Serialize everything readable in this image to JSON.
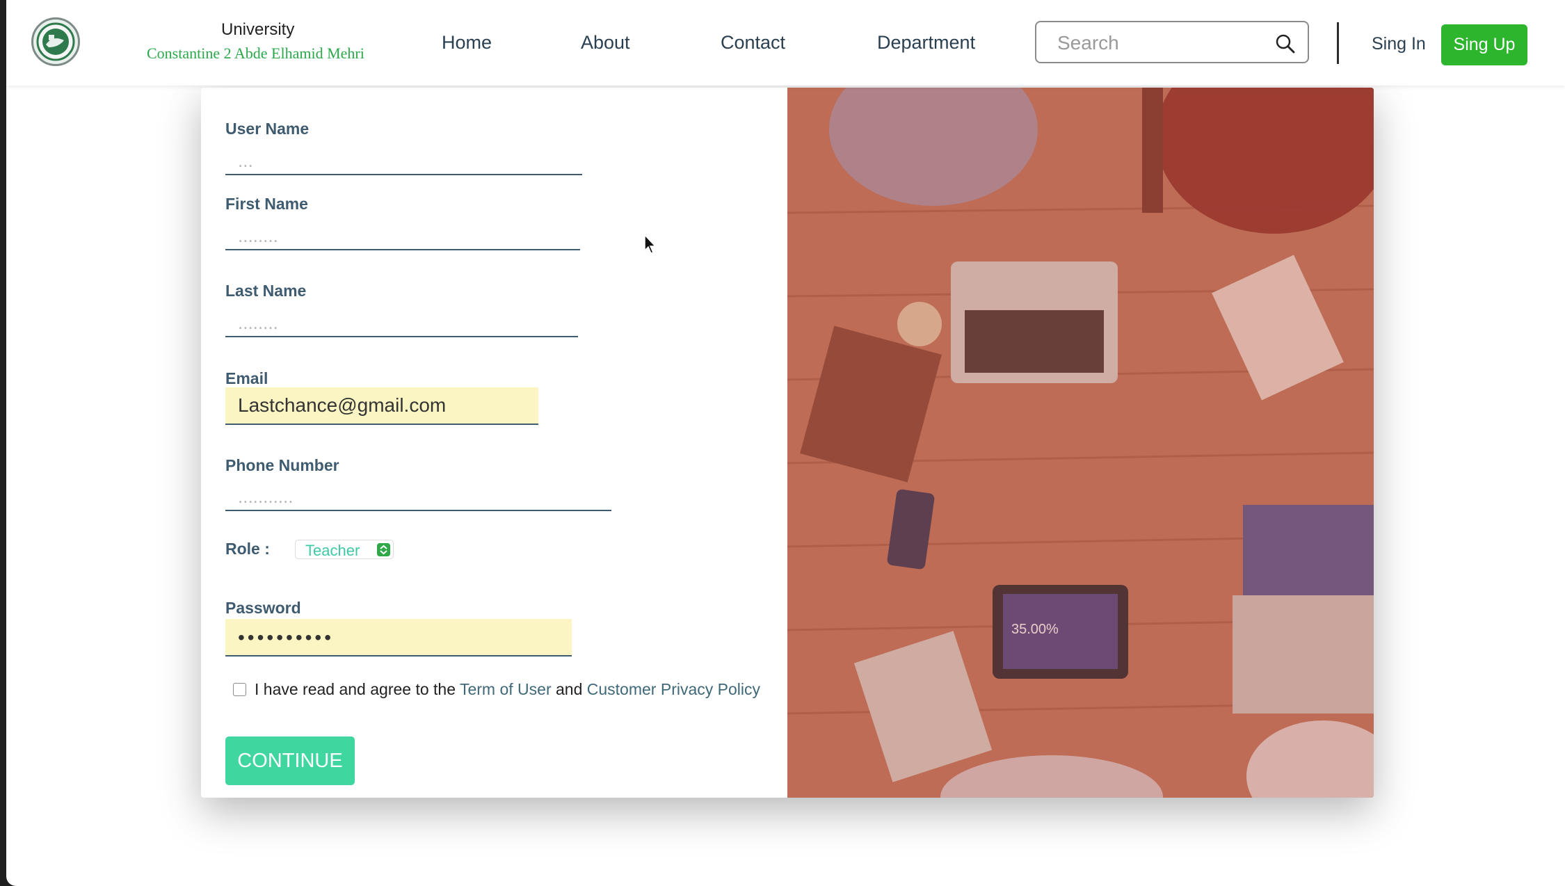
{
  "header": {
    "brand_line1": "University",
    "brand_line2": "Constantine 2 Abde Elhamid Mehri",
    "nav": [
      {
        "label": "Home"
      },
      {
        "label": "About"
      },
      {
        "label": "Contact"
      },
      {
        "label": "Department"
      }
    ],
    "search_placeholder": "Search",
    "signin_label": "Sing In",
    "signup_label": "Sing Up"
  },
  "form": {
    "username": {
      "label": "User Name",
      "placeholder": "...",
      "value": ""
    },
    "firstname": {
      "label": "First Name",
      "placeholder": "........",
      "value": ""
    },
    "lastname": {
      "label": "Last Name",
      "placeholder": "........",
      "value": ""
    },
    "email": {
      "label": "Email",
      "value": "Lastchance@gmail.com"
    },
    "phone": {
      "label": "Phone Number",
      "placeholder": "...........",
      "value": ""
    },
    "role": {
      "label": "Role :",
      "value": "Teacher"
    },
    "password": {
      "label": "Password",
      "value": "••••••••••"
    },
    "agreement": {
      "prefix": "I have read and agree to the ",
      "terms_link": "Term of User",
      "middle": " and ",
      "privacy_link": "Customer Privacy Policy"
    },
    "continue_label": "CONTINUE"
  },
  "colors": {
    "accent_green": "#2db52d",
    "continue_teal": "#3fd6a0",
    "label_slate": "#3f5b6f",
    "autofill_yellow": "#fbf5c4",
    "image_overlay": "#b96a52"
  },
  "icons": [
    "university-logo-icon",
    "search-icon",
    "role-stepper-icon",
    "mouse-cursor-icon"
  ]
}
